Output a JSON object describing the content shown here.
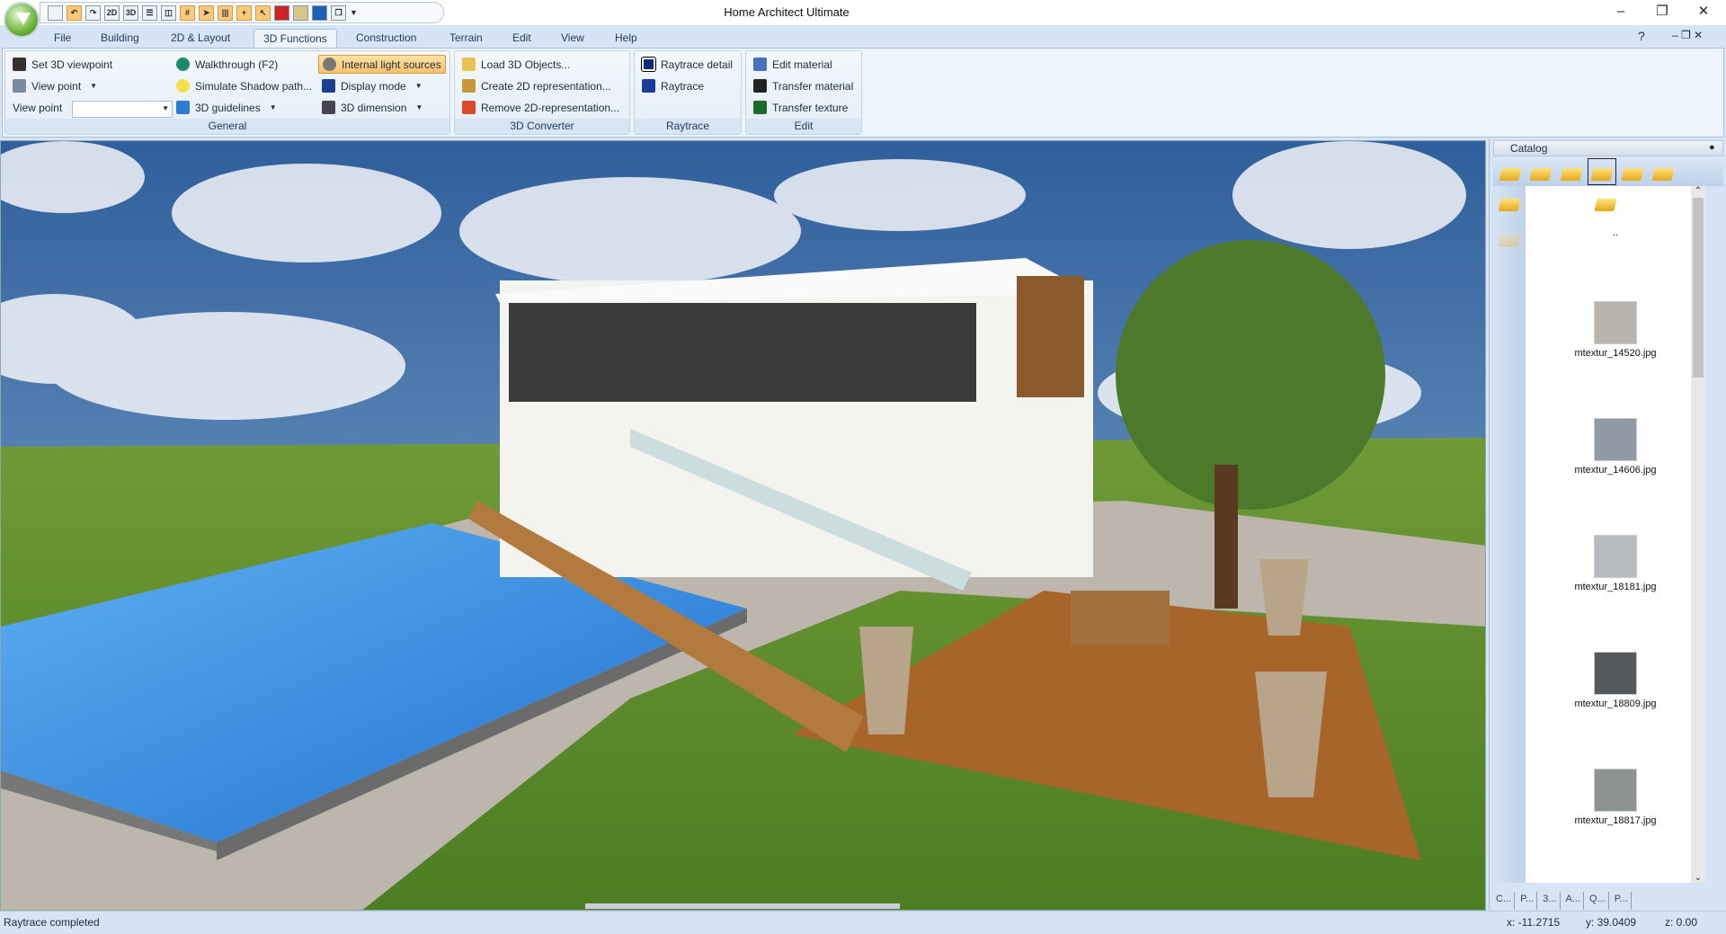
{
  "title": "Home Architect Ultimate",
  "quick_access": [
    "new",
    "undo",
    "redo",
    "2D",
    "3D",
    "split-h",
    "split-v",
    "grid",
    "select-3d",
    "walls",
    "measure",
    "pointer",
    "flag-red",
    "texture",
    "paint",
    "copy"
  ],
  "tabs": [
    {
      "label": "File"
    },
    {
      "label": "Building"
    },
    {
      "label": "2D & Layout"
    },
    {
      "label": "3D Functions",
      "active": true
    },
    {
      "label": "Construction"
    },
    {
      "label": "Terrain"
    },
    {
      "label": "Edit"
    },
    {
      "label": "View"
    },
    {
      "label": "Help"
    }
  ],
  "ribbon": {
    "general": {
      "label": "General",
      "items": [
        "Set 3D viewpoint",
        "View point",
        "Walkthrough (F2)",
        "Simulate Shadow path...",
        "3D guidelines",
        "Internal light sources",
        "Display mode",
        "3D dimension"
      ],
      "viewpoint_label": "View point",
      "viewpoint_value": ""
    },
    "converter": {
      "label": "3D Converter",
      "items": [
        "Load 3D Objects...",
        "Create 2D representation...",
        "Remove 2D-representation..."
      ]
    },
    "raytrace": {
      "label": "Raytrace",
      "items": [
        "Raytrace detail",
        "Raytrace"
      ]
    },
    "edit": {
      "label": "Edit",
      "items": [
        "Edit material",
        "Transfer material",
        "Transfer texture"
      ]
    }
  },
  "catalog": {
    "title": "Catalog",
    "up_label": "..",
    "items": [
      {
        "name": "mtextur_14520.jpg",
        "color": "#b9b4ad"
      },
      {
        "name": "mtextur_14606.jpg",
        "color": "#8f9aa6"
      },
      {
        "name": "mtextur_18181.jpg",
        "color": "#b7bcc0"
      },
      {
        "name": "mtextur_18809.jpg",
        "color": "#55595c"
      },
      {
        "name": "mtextur_18817.jpg",
        "color": "#8d9292"
      }
    ],
    "tabs": [
      "C...",
      "P...",
      "3...",
      "A...",
      "Q...",
      "P..."
    ]
  },
  "status": {
    "message": "Raytrace completed",
    "x": "x: -11.2715",
    "y": "y: 39.0409",
    "z": "z: 0.00"
  }
}
